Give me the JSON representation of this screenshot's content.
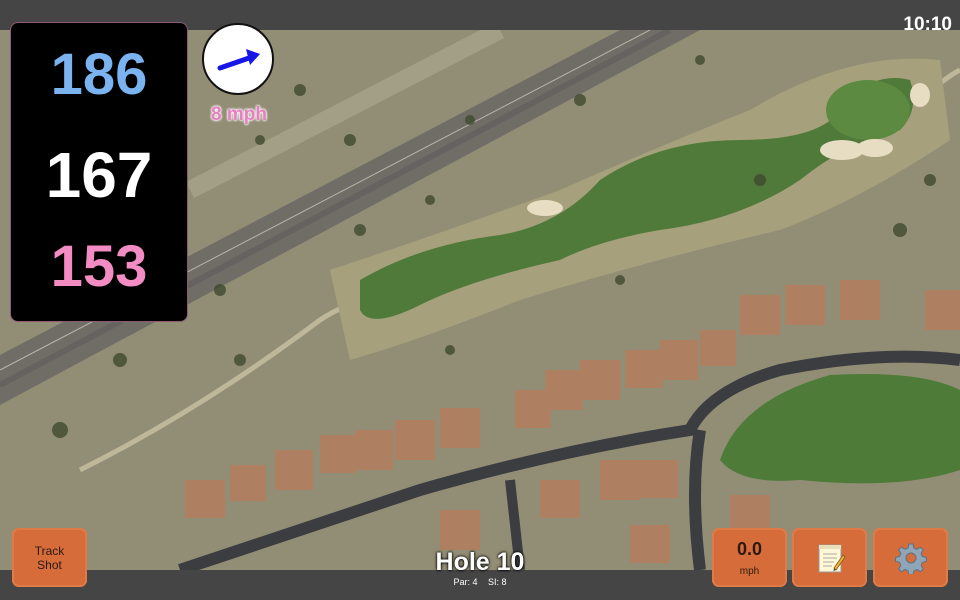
{
  "status_bar": {
    "time": "10:10"
  },
  "distances": {
    "back": "186",
    "center": "167",
    "front": "153"
  },
  "wind": {
    "speed_label": "8 mph",
    "direction_icon": "wind-arrow-icon"
  },
  "hole": {
    "title": "Hole 10",
    "par_label": "Par: 4",
    "si_label": "SI: 8"
  },
  "buttons": {
    "track_shot_line1": "Track",
    "track_shot_line2": "Shot",
    "speed_value": "0.0",
    "speed_unit": "mph",
    "notes_icon": "notepad-icon",
    "settings_icon": "gear-icon"
  },
  "colors": {
    "back_distance": "#7ab3f0",
    "center_distance": "#ffffff",
    "front_distance": "#f48cc4",
    "button_accent": "#d76c3b",
    "wind_label": "#e87fc0"
  }
}
